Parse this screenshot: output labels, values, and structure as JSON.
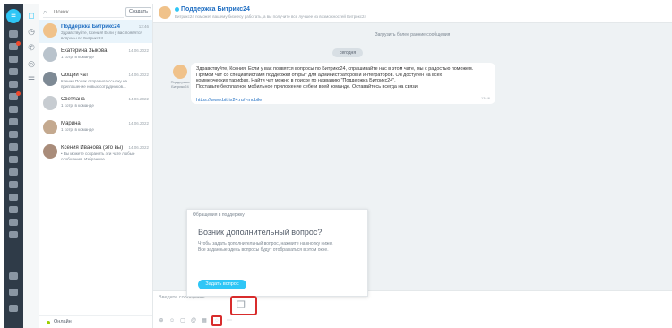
{
  "sidebar": {
    "search_placeholder": "Поиск",
    "create_label": "Создать",
    "status_label": "Онлайн",
    "chats": [
      {
        "name": "Поддержка Битрикс24",
        "date": "13:46",
        "preview": "Здравствуйте, Ксения! Если у вас появятся вопросы по Битрикс24..."
      },
      {
        "name": "Екатерина Зыкова",
        "date": "14.06.2022",
        "preview": "1 сотр. в команде"
      },
      {
        "name": "Общий чат",
        "date": "14.06.2022",
        "preview": "Ксения Поляк отправила ссылку на приглашение новых сотрудников..."
      },
      {
        "name": "Светлана",
        "date": "14.06.2022",
        "preview": "1 сотр. в команде"
      },
      {
        "name": "Марина",
        "date": "14.06.2022",
        "preview": "1 сотр. в команде"
      },
      {
        "name": "Ксения Иванова (это вы)",
        "date": "14.06.2022",
        "preview": "• Вы можете сохранить эти чате любые сообщения. Избранное..."
      }
    ]
  },
  "header": {
    "title": "Поддержка Битрикс24",
    "subtitle": "Битрикс24 поможет вашему бизнесу работать, а вы получите все лучшее из возможностей Битрикс24"
  },
  "messages": {
    "load_earlier": "Загрузить более ранние сообщения",
    "day": "сегодня",
    "sender": "Поддержка Битрикс24",
    "lines": [
      "Здравствуйте, Ксения! Если у вас появятся вопросы по Битрикс24, спрашивайте нас в этом чате, мы с радостью поможем.",
      "Прямой чат со специалистами поддержки открыт для администраторов и интеграторов. Он доступен на всех",
      "коммерческих тарифах. Найти чат можно в поиске по названию \"Поддержка Битрикс24\".",
      "Поставьте бесплатное мобильное приложение себе и всей команде. Оставайтесь всегда на связи:"
    ],
    "link": "https://www.bitrix24.ru/~mobile",
    "time": "13:46"
  },
  "input": {
    "placeholder": "Введите сообщение"
  },
  "popup": {
    "header": "Обращения в поддержку",
    "question": "Возник дополнительный вопрос?",
    "description": "Чтобы задать дополнительный вопрос, нажмите на кнопку ниже. Все заданные здесь вопросы будут отображаться в этом окне.",
    "button": "Задать вопрос"
  },
  "colors": {
    "accent": "#2fc6f6",
    "link": "#1f6ec2",
    "highlight": "#d82c2c"
  }
}
